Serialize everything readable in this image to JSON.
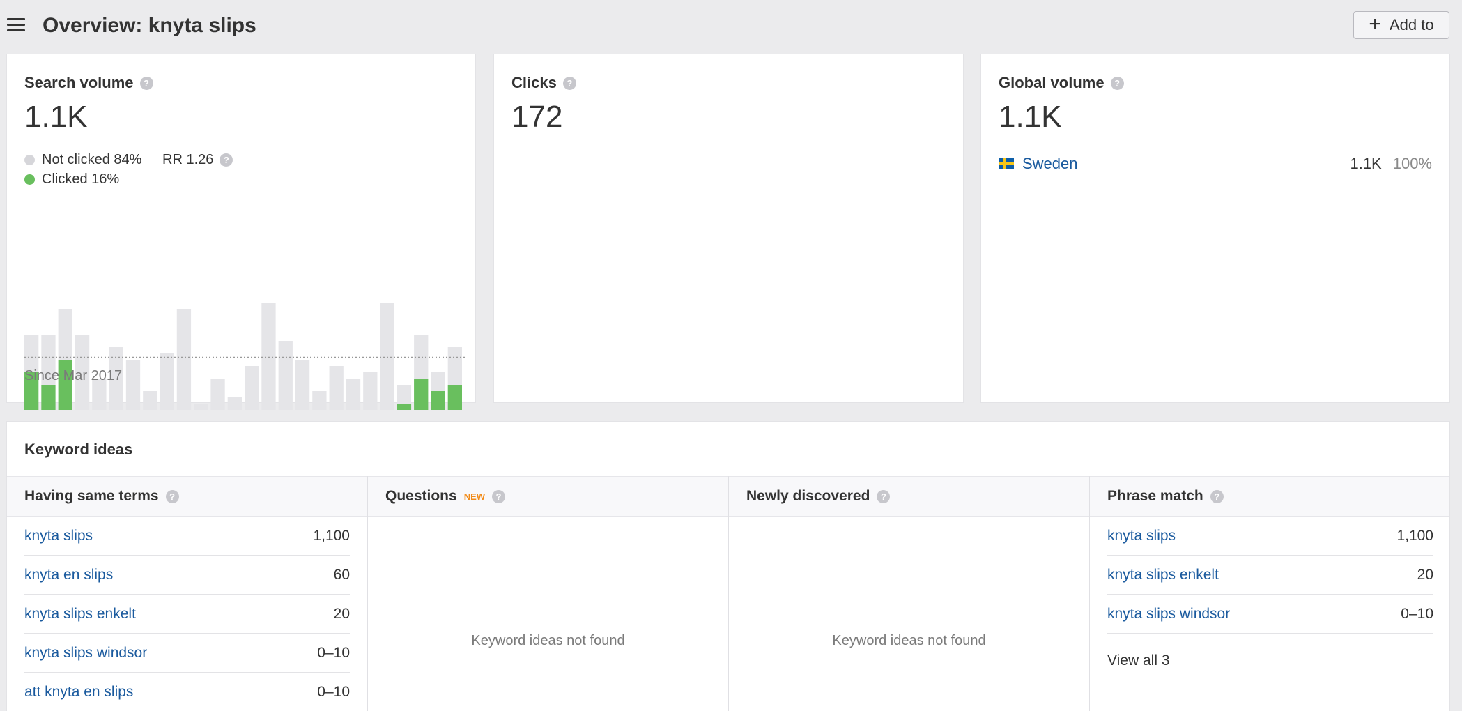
{
  "header": {
    "title": "Overview: knyta slips",
    "add_to_label": "Add to"
  },
  "search_volume": {
    "title": "Search volume",
    "value": "1.1K",
    "not_clicked": "Not clicked 84%",
    "clicked": "Clicked 16%",
    "rr": "RR 1.26",
    "since": "Since Mar 2017",
    "colors": {
      "clicked": "#69bf5e",
      "not_clicked": "#e5e5e8",
      "grid": "#999999"
    }
  },
  "chart_data": {
    "type": "bar",
    "stacked": true,
    "average_line": 42,
    "series": [
      {
        "values": [
          30,
          20,
          40,
          0,
          0,
          0,
          0,
          0,
          0,
          0,
          0,
          0,
          0,
          0,
          0,
          0,
          0,
          0,
          0,
          0,
          0,
          0,
          5,
          25,
          15,
          20
        ]
      },
      {
        "values": [
          30,
          40,
          40,
          60,
          25,
          50,
          40,
          15,
          45,
          80,
          5,
          25,
          10,
          35,
          85,
          55,
          40,
          15,
          35,
          25,
          30,
          85,
          15,
          35,
          15,
          30
        ]
      }
    ]
  },
  "clicks": {
    "title": "Clicks",
    "value": "172"
  },
  "global_volume": {
    "title": "Global volume",
    "value": "1.1K",
    "countries": [
      {
        "name": "Sweden",
        "volume": "1.1K",
        "share": "100%"
      }
    ]
  },
  "keyword_ideas": {
    "title": "Keyword ideas",
    "columns": [
      {
        "title": "Having same terms",
        "rows": [
          {
            "keyword": "knyta slips",
            "volume": "1,100"
          },
          {
            "keyword": "knyta en slips",
            "volume": "60"
          },
          {
            "keyword": "knyta slips enkelt",
            "volume": "20"
          },
          {
            "keyword": "knyta slips windsor",
            "volume": "0–10"
          },
          {
            "keyword": "att knyta en slips",
            "volume": "0–10"
          }
        ]
      },
      {
        "title": "Questions",
        "badge": "NEW",
        "empty": "Keyword ideas not found"
      },
      {
        "title": "Newly discovered",
        "empty": "Keyword ideas not found"
      },
      {
        "title": "Phrase match",
        "rows": [
          {
            "keyword": "knyta slips",
            "volume": "1,100"
          },
          {
            "keyword": "knyta slips enkelt",
            "volume": "20"
          },
          {
            "keyword": "knyta slips windsor",
            "volume": "0–10"
          }
        ],
        "view_all": "View all 3"
      }
    ]
  }
}
